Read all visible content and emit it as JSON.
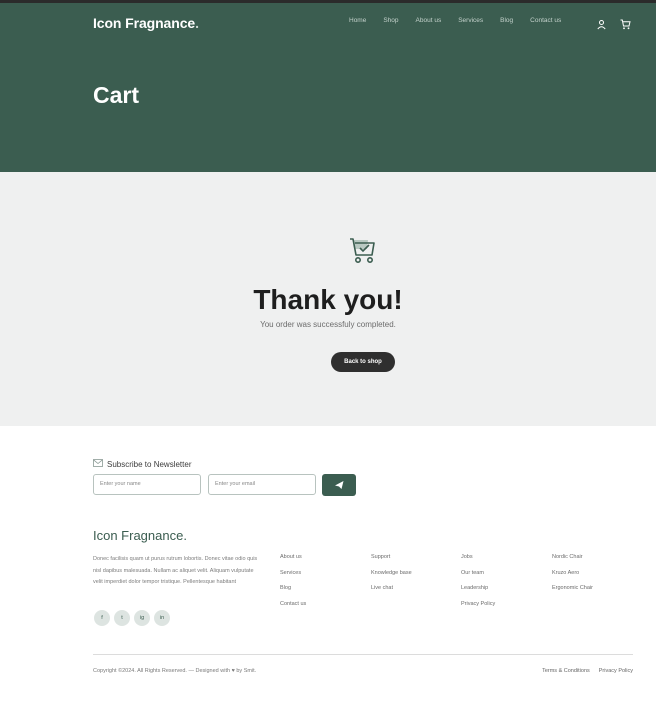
{
  "header": {
    "brand": "Icon Fragnance",
    "brand_dot": ".",
    "nav": [
      "Home",
      "Shop",
      "About us",
      "Services",
      "Blog",
      "Contact us"
    ],
    "icons": [
      "user-icon",
      "cart-icon"
    ]
  },
  "hero": {
    "title": "Cart"
  },
  "thank_you": {
    "icon": "shopping-cart-check-icon",
    "heading": "Thank you!",
    "message": "You order was successfuly completed.",
    "button": "Back to shop"
  },
  "newsletter": {
    "title": "Subscribe to Newsletter",
    "name_placeholder": "Enter your name",
    "email_placeholder": "Enter your email",
    "icon": "envelope-icon",
    "send_icon": "paper-plane-icon"
  },
  "footer": {
    "brand": "Icon Fragnance.",
    "description": "Donec facilisis quam ut purus rutrum lobortis. Donec vitae odio quis nisl dapibus malesuada. Nullam ac aliquet velit. Aliquam vulputate velit imperdiet dolor tempor tristique. Pellentesque habitant",
    "socials": [
      "f",
      "t",
      "ig",
      "in"
    ],
    "columns": [
      [
        "About us",
        "Services",
        "Blog",
        "Contact us"
      ],
      [
        "Support",
        "Knowledge base",
        "Live chat"
      ],
      [
        "Jobs",
        "Our team",
        "Leadership",
        "Privacy Policy"
      ],
      [
        "Nordic Chair",
        "Kruzo Aero",
        "Ergonomic Chair"
      ]
    ],
    "copyright": "Copyright ©2024. All Rights Reserved. — Designed with ♥ by Smit.",
    "legal": [
      "Terms & Conditions",
      "Privacy Policy"
    ]
  },
  "colors": {
    "brand_green": "#3b5d50",
    "dark_button": "#2f2f2f",
    "content_bg": "#eff0f0"
  }
}
